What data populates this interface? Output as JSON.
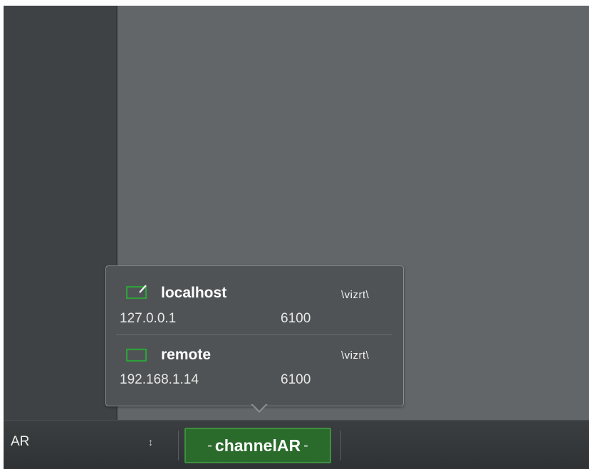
{
  "bottom_bar": {
    "mode_value": "AR",
    "stepper_icon": "stepper-icon",
    "channel_button": {
      "prefix": "-",
      "label": "channelAR",
      "suffix": "-",
      "color": "#2a6b2c"
    }
  },
  "engine_popup": {
    "hosts": [
      {
        "name": "localhost",
        "ip": "127.0.0.1",
        "port": "6100",
        "logo_text": "\\vizrt\\",
        "icon": "monitor-edit-icon",
        "icon_color": "#2ea03a"
      },
      {
        "name": "remote",
        "ip": "192.168.1.14",
        "port": "6100",
        "logo_text": "\\vizrt\\",
        "icon": "monitor-icon",
        "icon_color": "#2ea03a"
      }
    ]
  }
}
